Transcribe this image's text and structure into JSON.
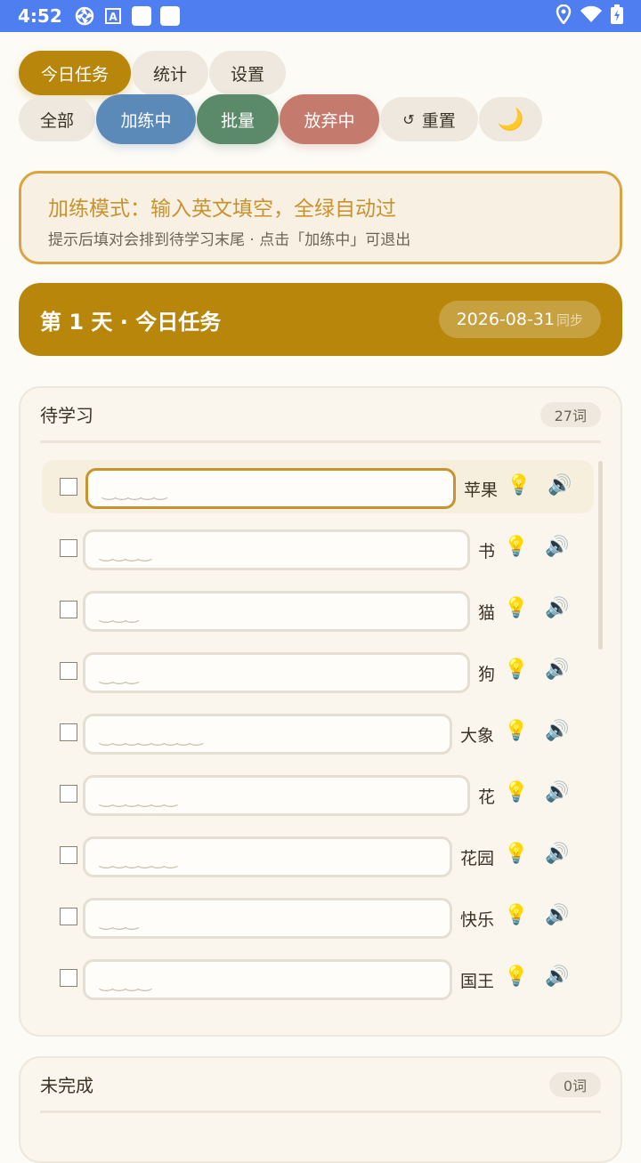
{
  "status": {
    "time": "4:52"
  },
  "tabs": [
    {
      "label": "今日任务"
    },
    {
      "label": "统计"
    },
    {
      "label": "设置"
    }
  ],
  "filters": {
    "all": "全部",
    "practice": "加练中",
    "batch": "批量",
    "giveup": "放弃中",
    "reset": "重置",
    "reset_symbol": "↺",
    "theme_icon": "🌙"
  },
  "notice": {
    "title": "加练模式：输入英文填空，全绿自动过",
    "subtitle": "提示后填对会排到待学习末尾 · 点击「加练中」可退出"
  },
  "day": {
    "title": "第 1 天 · 今日任务",
    "date": "2026-08-31",
    "sync": "同步"
  },
  "pending": {
    "name": "待学习",
    "count": "27词",
    "items": [
      {
        "word": "苹果",
        "blanks": "‿‿‿‿‿"
      },
      {
        "word": "书",
        "blanks": "‿‿‿‿"
      },
      {
        "word": "猫",
        "blanks": "‿‿‿"
      },
      {
        "word": "狗",
        "blanks": "‿‿‿"
      },
      {
        "word": "大象",
        "blanks": "‿‿‿‿‿‿‿‿"
      },
      {
        "word": "花",
        "blanks": "‿‿‿‿‿‿"
      },
      {
        "word": "花园",
        "blanks": "‿‿‿‿‿‿"
      },
      {
        "word": "快乐",
        "blanks": "‿‿‿"
      },
      {
        "word": "国王",
        "blanks": "‿‿‿‿"
      }
    ]
  },
  "incomplete": {
    "name": "未完成",
    "count": "0词"
  },
  "colors": {
    "accent": "#b8860b",
    "practice": "#5b8ab8",
    "batch": "#5b8a6a",
    "giveup": "#c47a6c",
    "statusbar": "#4f7ef0"
  },
  "icons": {
    "hint": "💡",
    "speaker": "🔊"
  }
}
